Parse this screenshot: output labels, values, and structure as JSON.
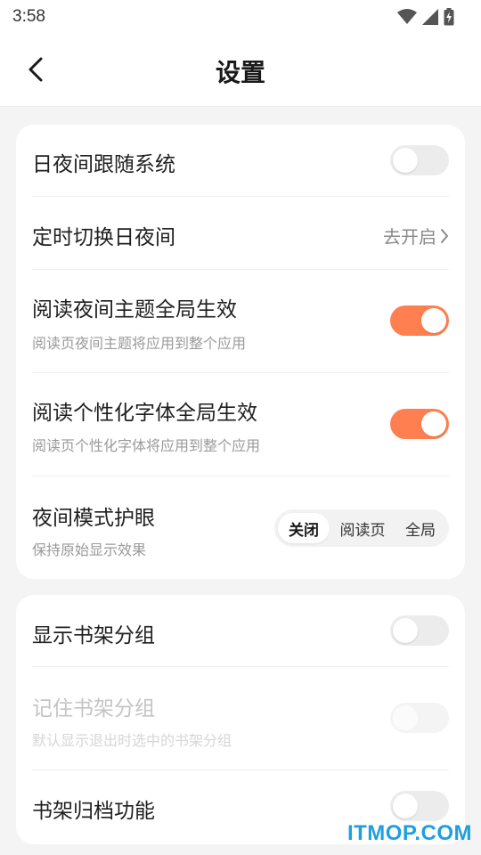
{
  "status_bar": {
    "time": "3:58",
    "icons": [
      "wifi-icon",
      "signal-icon",
      "battery-charging-icon"
    ]
  },
  "header": {
    "title": "设置",
    "back_icon": "chevron-left-icon"
  },
  "card1": {
    "follow_system": {
      "title": "日夜间跟随系统",
      "toggle_on": false
    },
    "scheduled_switch": {
      "title": "定时切换日夜间",
      "action": "去开启"
    },
    "night_theme_global": {
      "title": "阅读夜间主题全局生效",
      "subtitle": "阅读页夜间主题将应用到整个应用",
      "toggle_on": true
    },
    "custom_font_global": {
      "title": "阅读个性化字体全局生效",
      "subtitle": "阅读页个性化字体将应用到整个应用",
      "toggle_on": true
    },
    "night_eye_care": {
      "title": "夜间模式护眼",
      "subtitle": "保持原始显示效果",
      "options": [
        "关闭",
        "阅读页",
        "全局"
      ],
      "selected": "关闭"
    }
  },
  "card2": {
    "shelf_groups": {
      "title": "显示书架分组",
      "toggle_on": false
    },
    "remember_groups": {
      "title": "记住书架分组",
      "subtitle": "默认显示退出时选中的书架分组",
      "toggle_on": false,
      "disabled": true
    },
    "shelf_archive": {
      "title": "书架归档功能",
      "toggle_on": false
    }
  },
  "watermark": "ITMOP.COM",
  "colors": {
    "accent": "#ff7f50",
    "background": "#f4f4f4",
    "watermark": "#1f9fe0"
  }
}
